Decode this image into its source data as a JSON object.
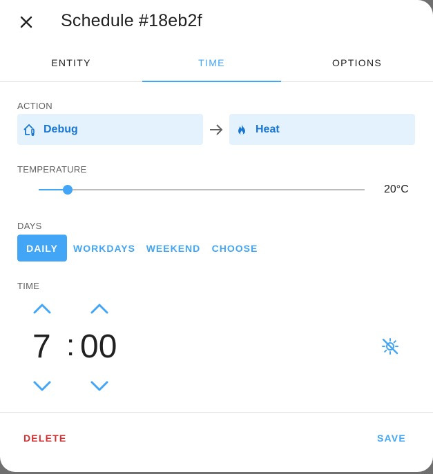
{
  "dialog": {
    "title": "Schedule #18eb2f"
  },
  "tabs": [
    {
      "label": "ENTITY"
    },
    {
      "label": "TIME"
    },
    {
      "label": "OPTIONS"
    }
  ],
  "action": {
    "section_label": "ACTION",
    "from_label": "Debug",
    "to_label": "Heat"
  },
  "temperature": {
    "section_label": "TEMPERATURE",
    "value_text": "20°C",
    "slider_fraction": 0.09
  },
  "days": {
    "section_label": "DAYS",
    "options": [
      "DAILY",
      "WORKDAYS",
      "WEEKEND",
      "CHOOSE"
    ],
    "selected": "DAILY"
  },
  "time": {
    "section_label": "TIME",
    "hours": "7",
    "separator": ":",
    "minutes": "00"
  },
  "footer": {
    "delete_label": "DELETE",
    "save_label": "SAVE"
  },
  "colors": {
    "accent": "#42a5f5",
    "danger": "#d32f2f",
    "chip_bg": "#e3f2fd"
  }
}
